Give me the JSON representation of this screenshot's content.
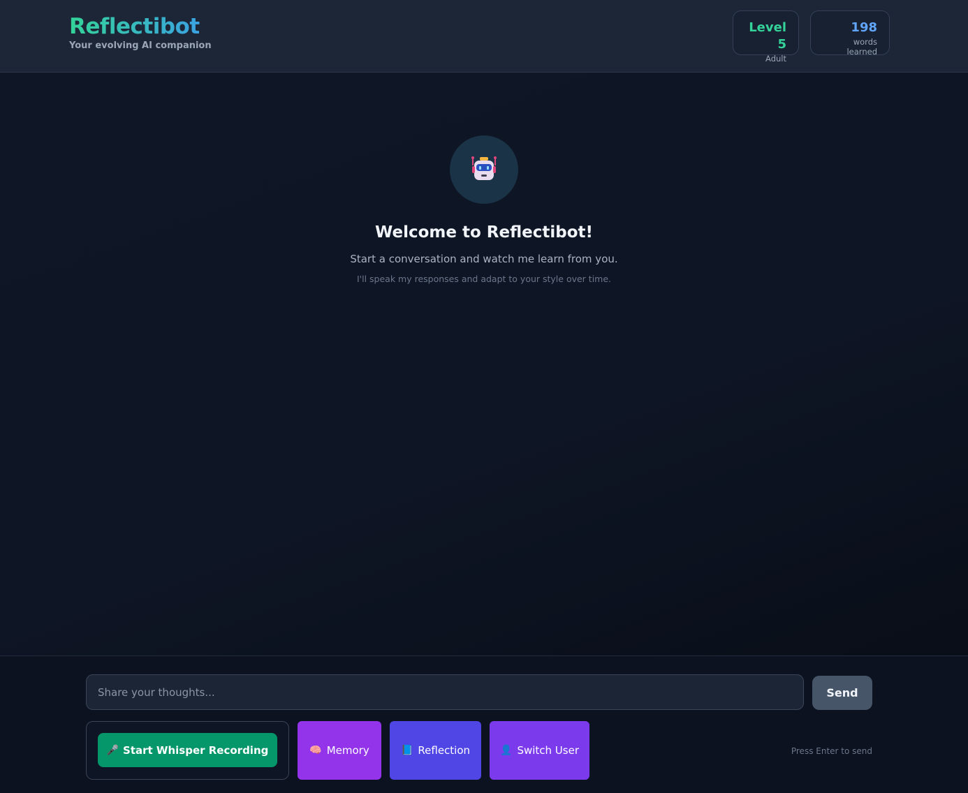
{
  "header": {
    "title": "Reflectibot",
    "subtitle": "Your evolving AI companion",
    "level": {
      "value": "Level 5",
      "label": "Adult"
    },
    "words": {
      "value": "198",
      "label": "words learned"
    }
  },
  "welcome": {
    "avatar_icon": "robot-icon",
    "title": "Welcome to Reflectibot!",
    "text": "Start a conversation and watch me learn from you.",
    "hint": "I'll speak my responses and adapt to your style over time."
  },
  "composer": {
    "placeholder": "Share your thoughts...",
    "value": "",
    "send_label": "Send",
    "whisper_label": "Start Whisper Recording",
    "whisper_icon": "microphone-icon",
    "memory_label": "Memory",
    "memory_icon": "brain-icon",
    "reflection_label": "Reflection",
    "reflection_icon": "book-icon",
    "switch_user_label": "Switch User",
    "switch_user_icon": "user-icon",
    "enter_hint": "Press Enter to send"
  },
  "colors": {
    "accent_green": "#34d399",
    "accent_blue": "#60a5fa",
    "whisper": "#059669",
    "memory": "#9333ea",
    "reflection": "#4f46e5",
    "switch_user": "#7c3aed",
    "send": "#475569"
  }
}
